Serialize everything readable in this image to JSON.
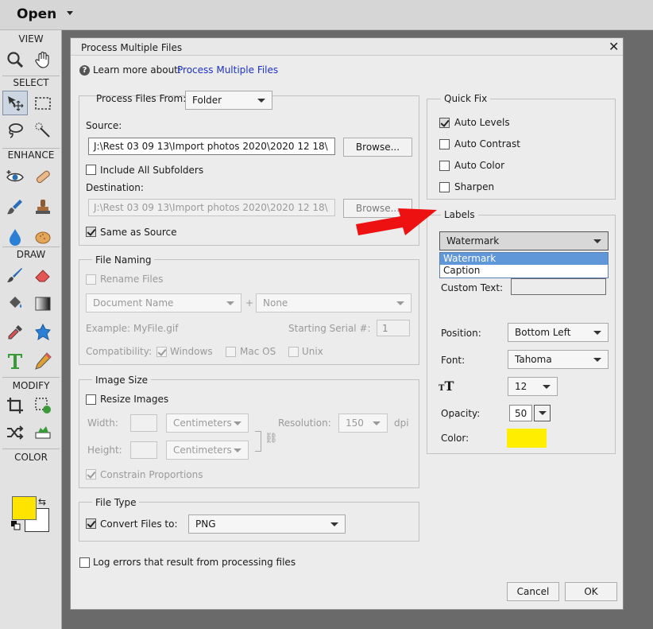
{
  "topbar": {
    "open_label": "Open"
  },
  "toolbar": {
    "view": "VIEW",
    "select": "SELECT",
    "enhance": "ENHANCE",
    "draw": "DRAW",
    "modify": "MODIFY",
    "color": "COLOR",
    "fg_color": "#ffe400",
    "bg_color": "#ffffff"
  },
  "dialog": {
    "title": "Process Multiple Files",
    "close": "✕",
    "learn_text": "Learn more about:",
    "learn_link": "Process Multiple Files",
    "process_from": {
      "label": "Process Files From:",
      "value": "Folder"
    },
    "source": {
      "label": "Source:",
      "path": "J:\\Rest 03 09 13\\Import photos 2020\\2020 12 18\\",
      "browse": "Browse..."
    },
    "include_subfolders": "Include All Subfolders",
    "destination": {
      "label": "Destination:",
      "path": "J:\\Rest 03 09 13\\Import photos 2020\\2020 12 18\\",
      "browse": "Browse..."
    },
    "same_as_source": "Same as Source",
    "file_naming": {
      "legend": "File Naming",
      "rename": "Rename Files",
      "name_part": "Document Name",
      "plus": "+",
      "suffix": "None",
      "example": "Example: MyFile.gif",
      "serial_label": "Starting Serial #:",
      "serial_value": "1",
      "compat": "Compatibility:",
      "windows": "Windows",
      "macos": "Mac OS",
      "unix": "Unix"
    },
    "image_size": {
      "legend": "Image Size",
      "resize": "Resize Images",
      "width": "Width:",
      "height": "Height:",
      "units": "Centimeters",
      "resolution": "Resolution:",
      "res_value": "150",
      "dpi": "dpi",
      "constrain": "Constrain Proportions"
    },
    "file_type": {
      "legend": "File Type",
      "convert": "Convert Files to:",
      "format": "PNG"
    },
    "log_errors": "Log errors that result from processing files",
    "quick_fix": {
      "legend": "Quick Fix",
      "auto_levels": "Auto Levels",
      "auto_contrast": "Auto Contrast",
      "auto_color": "Auto Color",
      "sharpen": "Sharpen"
    },
    "labels": {
      "legend": "Labels",
      "selected": "Watermark",
      "options": [
        "Watermark",
        "Caption"
      ],
      "custom_text": "Custom Text:",
      "position_label": "Position:",
      "position": "Bottom Left",
      "font_label": "Font:",
      "font": "Tahoma",
      "size": "12",
      "opacity_label": "Opacity:",
      "opacity": "50",
      "color_label": "Color:",
      "color": "#ffee00"
    },
    "cancel": "Cancel",
    "ok": "OK"
  }
}
